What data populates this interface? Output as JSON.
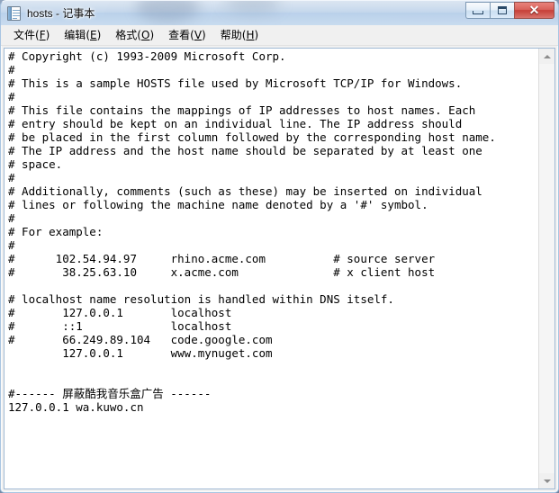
{
  "window": {
    "title": "hosts - 记事本",
    "app_icon": "notepad-document-icon",
    "controls": {
      "minimize_label": "",
      "maximize_label": "",
      "close_label": "✕"
    },
    "accent_close_color": "#c63f38",
    "frame_color": "#a5c3e2"
  },
  "menubar": {
    "items": [
      {
        "text": "文件",
        "acc": "F"
      },
      {
        "text": "编辑",
        "acc": "E"
      },
      {
        "text": "格式",
        "acc": "O"
      },
      {
        "text": "查看",
        "acc": "V"
      },
      {
        "text": "帮助",
        "acc": "H"
      }
    ]
  },
  "editor": {
    "content": "# Copyright (c) 1993-2009 Microsoft Corp.\n#\n# This is a sample HOSTS file used by Microsoft TCP/IP for Windows.\n#\n# This file contains the mappings of IP addresses to host names. Each\n# entry should be kept on an individual line. The IP address should\n# be placed in the first column followed by the corresponding host name.\n# The IP address and the host name should be separated by at least one\n# space.\n#\n# Additionally, comments (such as these) may be inserted on individual\n# lines or following the machine name denoted by a '#' symbol.\n#\n# For example:\n#\n#      102.54.94.97     rhino.acme.com          # source server\n#       38.25.63.10     x.acme.com              # x client host\n\n# localhost name resolution is handled within DNS itself.\n#       127.0.0.1       localhost\n#       ::1             localhost\n#       66.249.89.104   code.google.com\n        127.0.0.1       www.mynuget.com\n\n\n#------ 屏蔽酷我音乐盒广告 ------\n127.0.0.1 wa.kuwo.cn\n"
  },
  "scrollbar": {
    "up_arrow": "scroll-up-arrow",
    "down_arrow": "scroll-down-arrow"
  }
}
